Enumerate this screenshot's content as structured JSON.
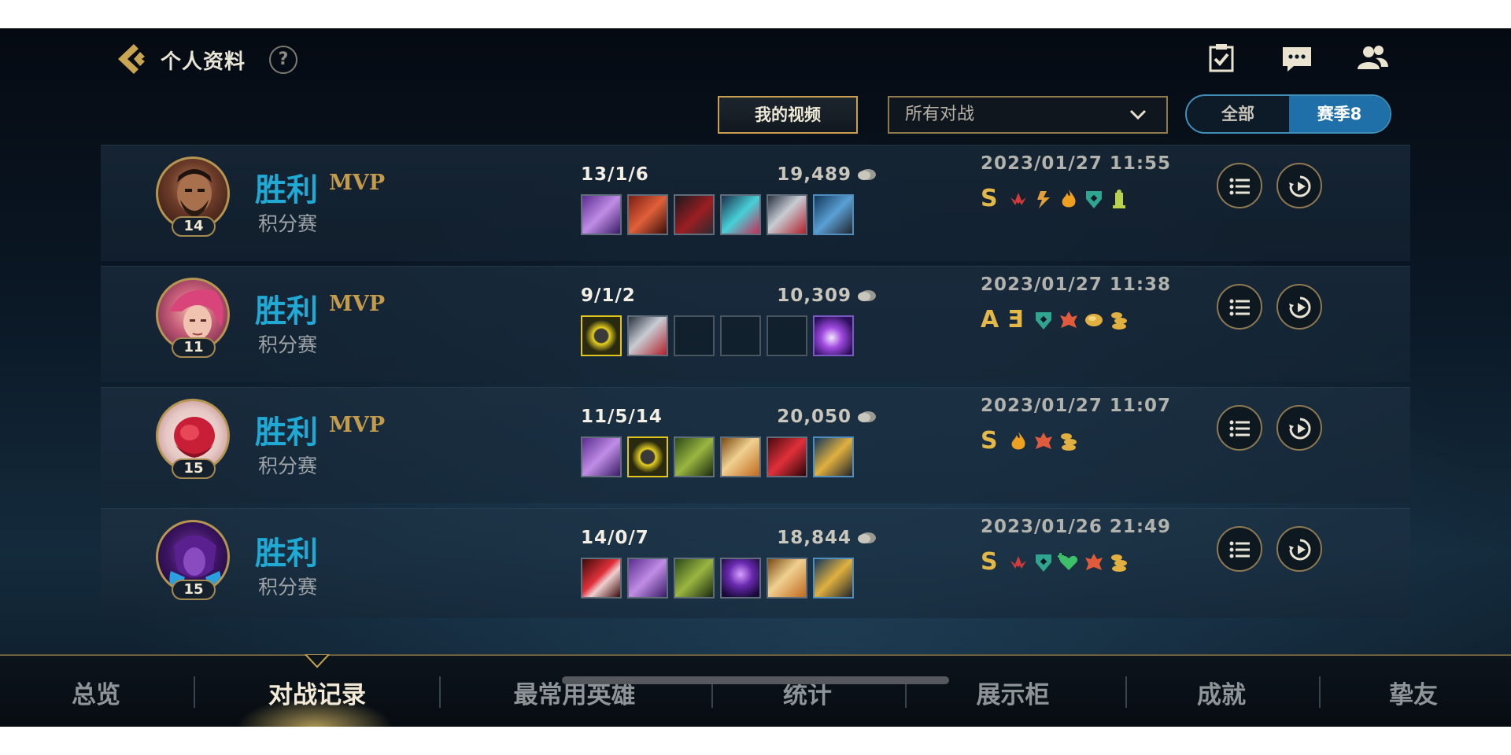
{
  "header": {
    "title": "个人资料",
    "help_glyph": "?",
    "icons": [
      "task-icon",
      "chat-icon",
      "friends-icon"
    ]
  },
  "filters": {
    "video_button": "我的视频",
    "mode_select": "所有对战",
    "season_all": "全部",
    "season_current": "赛季8"
  },
  "matches": [
    {
      "result": "胜利",
      "mvp": "MVP",
      "mode": "积分赛",
      "level": "14",
      "kda": "13/1/6",
      "gold": "19,489",
      "datetime": "2023/01/27 11:55",
      "grade": "S",
      "badges": [
        "#d63a3a",
        "#e3a03a",
        "#f0a020",
        "#2fa48e",
        "#b8d24a"
      ]
    },
    {
      "result": "胜利",
      "mvp": "MVP",
      "mode": "积分赛",
      "level": "11",
      "kda": "9/1/2",
      "gold": "10,309",
      "datetime": "2023/01/27 11:38",
      "grade": "A",
      "grade2": "Ǝ",
      "badges": [
        "#2fa48e",
        "#e05a3c",
        "#e2b040",
        "#e2b040"
      ]
    },
    {
      "result": "胜利",
      "mvp": "MVP",
      "mode": "积分赛",
      "level": "15",
      "kda": "11/5/14",
      "gold": "20,050",
      "datetime": "2023/01/27 11:07",
      "grade": "S",
      "badges": [
        "#f0a020",
        "#e05a3c",
        "#e2b040"
      ]
    },
    {
      "result": "胜利",
      "mvp": "",
      "mode": "积分赛",
      "level": "15",
      "kda": "14/0/7",
      "gold": "18,844",
      "datetime": "2023/01/26 21:49",
      "grade": "S",
      "badges": [
        "#d63a3a",
        "#2fa48e",
        "#3ec06a",
        "#e05a3c",
        "#e2b040"
      ]
    }
  ],
  "tabs": [
    "总览",
    "对战记录",
    "最常用英雄",
    "统计",
    "展示柜",
    "成就",
    "挚友"
  ],
  "active_tab": "对战记录"
}
